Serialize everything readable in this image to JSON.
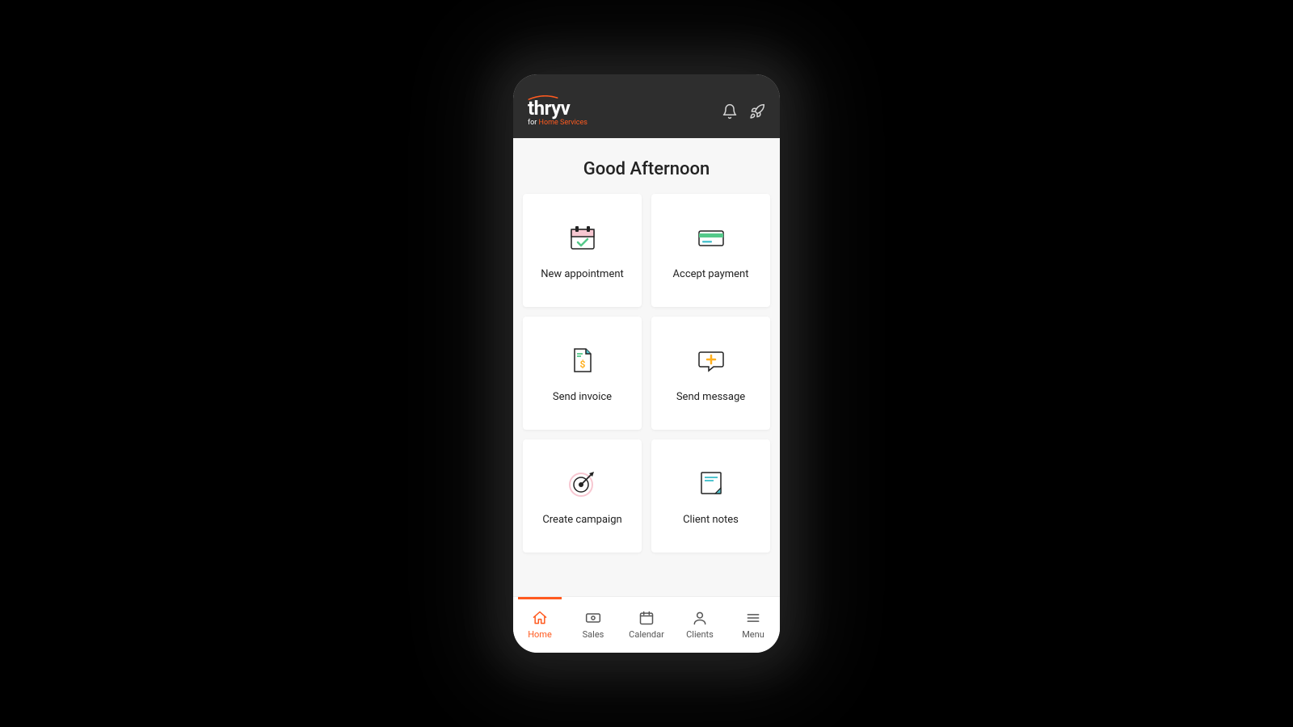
{
  "brand": {
    "word": "thryv",
    "sub_prefix": "for ",
    "sub_service": "Home Services"
  },
  "greeting": "Good Afternoon",
  "tiles": [
    {
      "id": "new-appointment",
      "label": "New appointment"
    },
    {
      "id": "accept-payment",
      "label": "Accept payment"
    },
    {
      "id": "send-invoice",
      "label": "Send invoice"
    },
    {
      "id": "send-message",
      "label": "Send message"
    },
    {
      "id": "create-campaign",
      "label": "Create campaign"
    },
    {
      "id": "client-notes",
      "label": "Client notes"
    }
  ],
  "nav": {
    "home": "Home",
    "sales": "Sales",
    "calendar": "Calendar",
    "clients": "Clients",
    "menu": "Menu"
  }
}
